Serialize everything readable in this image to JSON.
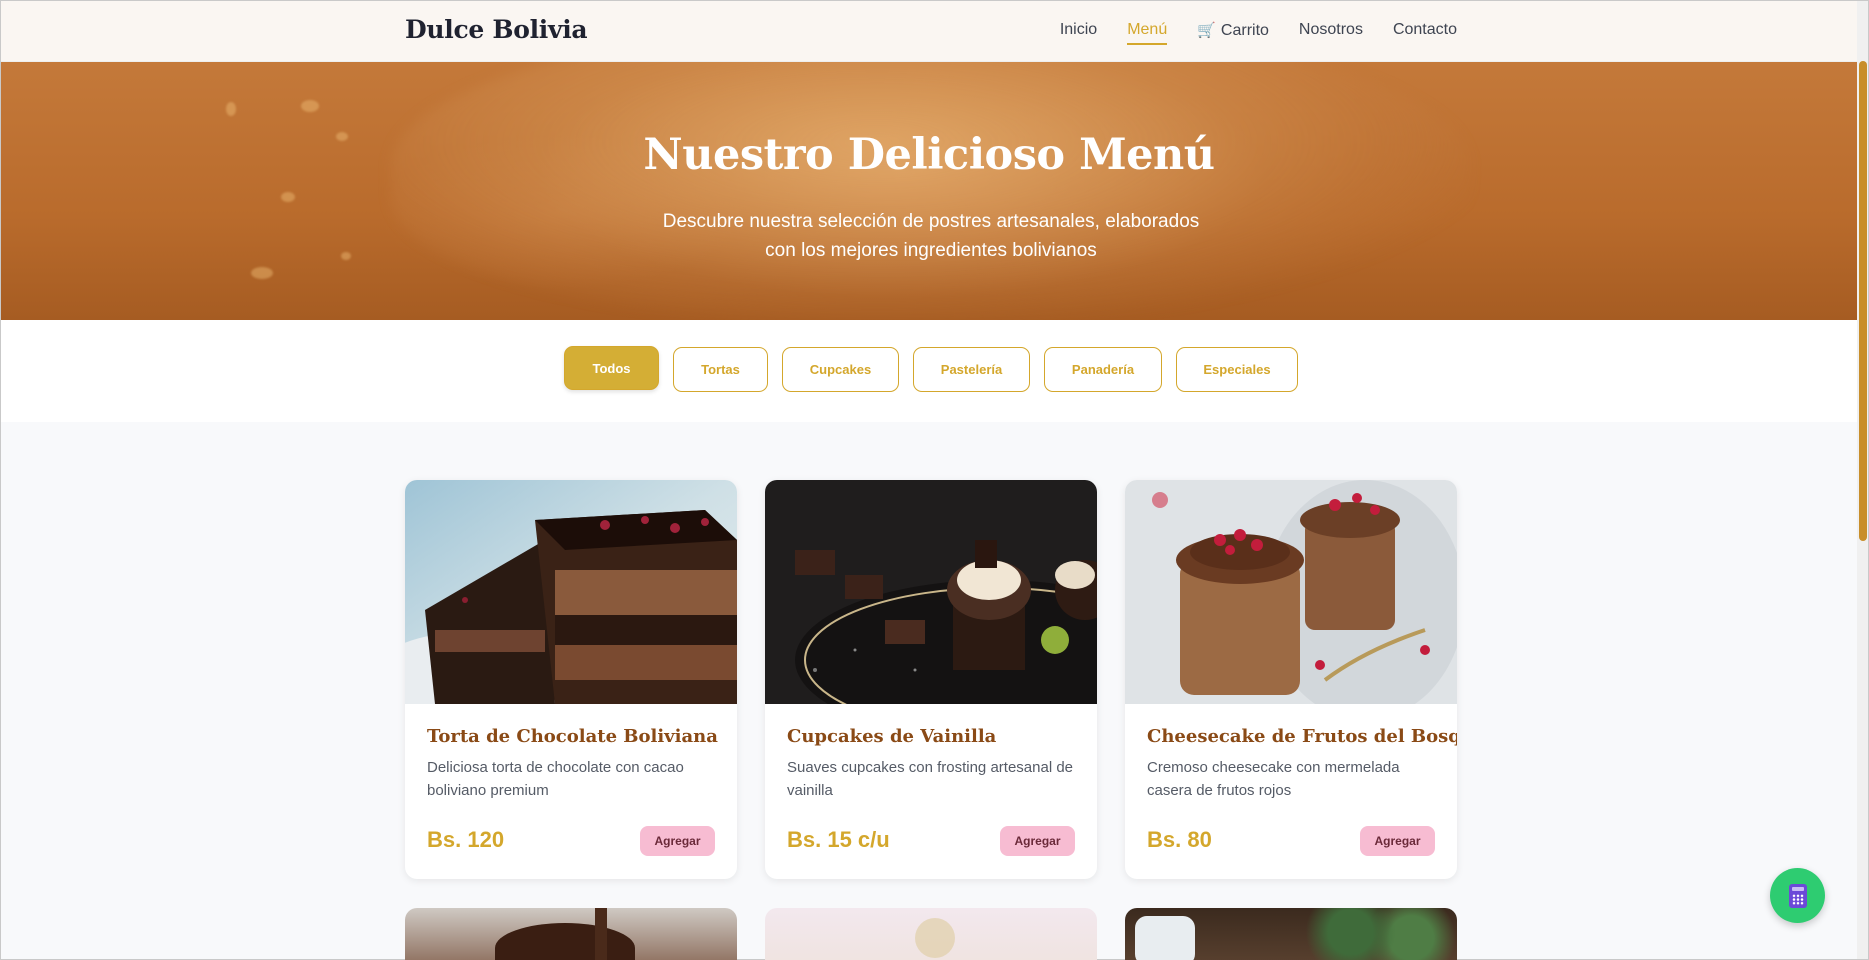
{
  "navbar": {
    "brand": "Dulce Bolivia",
    "links": [
      {
        "label": "Inicio",
        "active": false
      },
      {
        "label": "Menú",
        "active": true
      },
      {
        "label": "Carrito",
        "icon": "cart-icon",
        "active": false
      },
      {
        "label": "Nosotros",
        "active": false
      },
      {
        "label": "Contacto",
        "active": false
      }
    ]
  },
  "hero": {
    "title": "Nuestro Delicioso Menú",
    "subtitle": "Descubre nuestra selección de postres artesanales, elaborados con los mejores ingredientes bolivianos"
  },
  "filters": [
    {
      "label": "Todos",
      "active": true
    },
    {
      "label": "Tortas",
      "active": false
    },
    {
      "label": "Cupcakes",
      "active": false
    },
    {
      "label": "Pastelería",
      "active": false
    },
    {
      "label": "Panadería",
      "active": false
    },
    {
      "label": "Especiales",
      "active": false
    }
  ],
  "products": [
    {
      "name": "Torta de Chocolate Boliviana",
      "description": "Deliciosa torta de chocolate con cacao boliviano premium",
      "price": "Bs. 120",
      "button": "Agregar"
    },
    {
      "name": "Cupcakes de Vainilla",
      "description": "Suaves cupcakes con frosting artesanal de vainilla",
      "price": "Bs. 15 c/u",
      "button": "Agregar"
    },
    {
      "name": "Cheesecake de Frutos del Bosque",
      "description": "Cremoso cheesecake con mermelada casera de frutos rojos",
      "price": "Bs. 80",
      "button": "Agregar"
    }
  ],
  "colors": {
    "accent": "#d4a72c",
    "title": "#8a4a16",
    "button_pink": "#f7bcd2",
    "fab": "#2ecc71"
  },
  "fab": {
    "icon": "calculator-icon"
  }
}
